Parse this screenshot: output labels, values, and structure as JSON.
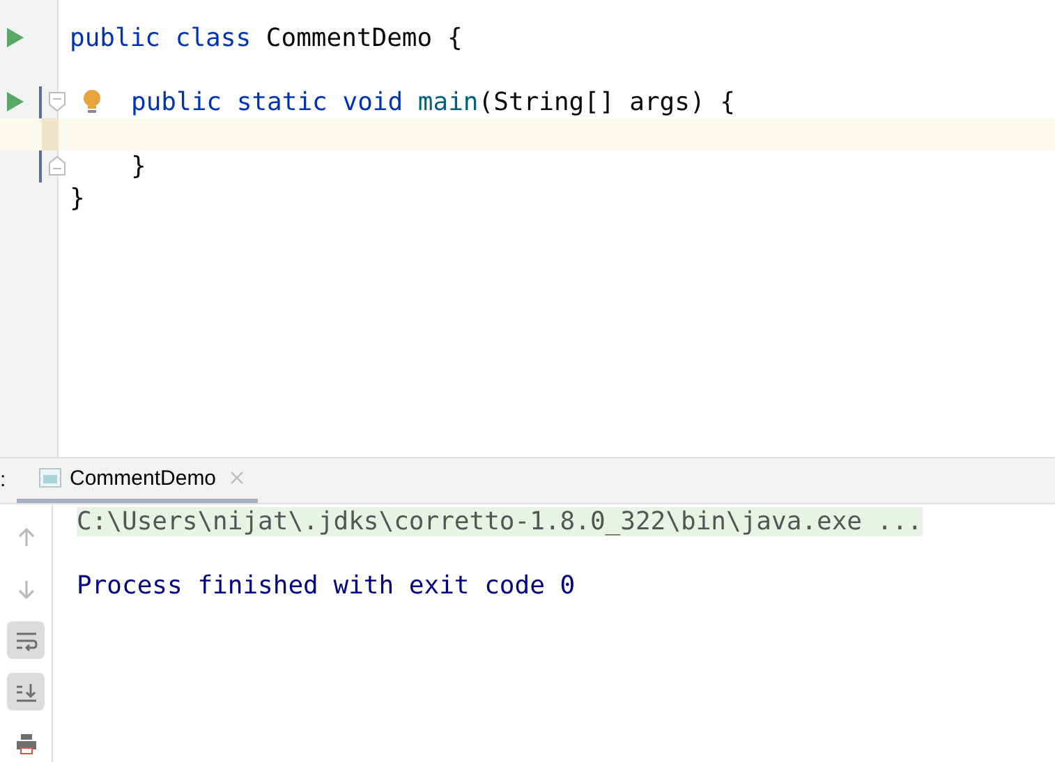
{
  "editor": {
    "lines": [
      {
        "kind": "code",
        "icons": [
          {
            "kind": "run"
          }
        ],
        "tokens": [
          {
            "text": "public",
            "kind": "keyword"
          },
          {
            "text": " class",
            "kind": "keyword"
          },
          {
            "text": " CommentDemo {",
            "kind": "plain"
          }
        ],
        "children": [
          {
            "kind": "blank"
          },
          {
            "kind": "code",
            "icons": [
              {
                "kind": "run"
              },
              {
                "kind": "fold-start"
              },
              {
                "kind": "intention"
              }
            ],
            "tokens": [
              {
                "text": "public",
                "kind": "keyword"
              },
              {
                "text": " static",
                "kind": "keyword"
              },
              {
                "text": " void",
                "kind": "keyword"
              },
              {
                "text": " main",
                "kind": "method"
              },
              {
                "text": "(String[] args) {",
                "kind": "plain"
              }
            ],
            "children": [
              {
                "kind": "blank",
                "current": true
              }
            ]
          },
          {
            "kind": "code",
            "icons": [
              {
                "kind": "fold-end"
              }
            ],
            "tokens": [
              {
                "text": "}",
                "kind": "plain"
              }
            ]
          }
        ]
      },
      {
        "kind": "code",
        "tokens": [
          {
            "text": "}",
            "kind": "plain"
          }
        ]
      }
    ]
  },
  "run_panel": {
    "label_fragment": ":",
    "tabs": [
      {
        "label": "CommentDemo",
        "selected": true
      }
    ],
    "toolbar": [
      {
        "kind": "up",
        "toggled": false
      },
      {
        "kind": "down",
        "toggled": false
      },
      {
        "kind": "wrap",
        "toggled": true
      },
      {
        "kind": "scroll-end",
        "toggled": true
      },
      {
        "kind": "print",
        "toggled": false
      }
    ],
    "console": [
      {
        "kind": "command",
        "text": "C:\\Users\\nijat\\.jdks\\corretto-1.8.0_322\\bin\\java.exe ..."
      },
      {
        "kind": "blank"
      },
      {
        "kind": "system",
        "text": "Process finished with exit code 0"
      }
    ]
  }
}
